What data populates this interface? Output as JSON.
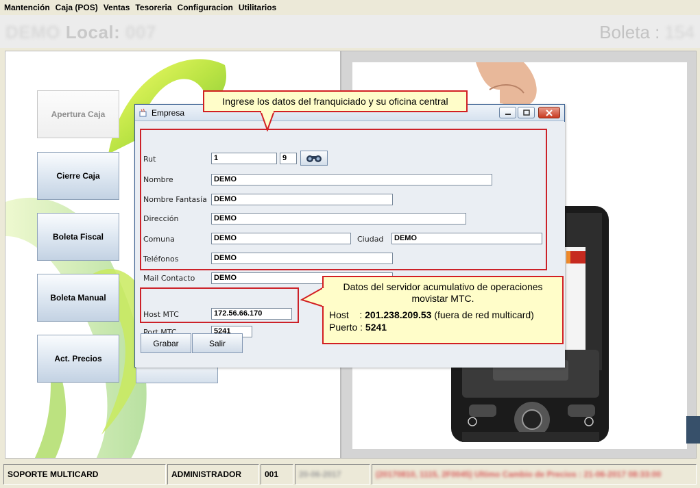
{
  "menu": [
    "Mantención",
    "Caja (POS)",
    "Ventas",
    "Tesoreria",
    "Configuracion",
    "Utilitarios"
  ],
  "header": {
    "local_name": "DEMO",
    "local_label": "Local:",
    "local_number": "007",
    "boleta_label": "Boleta :",
    "boleta_number": "154"
  },
  "side_buttons": [
    "Apertura Caja",
    "Cierre Caja",
    "Boleta Fiscal",
    "Boleta Manual",
    "Act. Precios"
  ],
  "dialog": {
    "title": "Empresa",
    "fields": {
      "rut_label": "Rut",
      "rut_value": "1",
      "rut_dv": "9",
      "nombre_label": "Nombre",
      "nombre_value": "DEMO",
      "fantasia_label": "Nombre Fantasía",
      "fantasia_value": "DEMO",
      "direccion_label": "Dirección",
      "direccion_value": "DEMO",
      "comuna_label": "Comuna",
      "comuna_value": "DEMO",
      "ciudad_label": "Ciudad",
      "ciudad_value": "DEMO",
      "telefonos_label": "Teléfonos",
      "telefonos_value": "DEMO",
      "mail_label": "Mail Contacto",
      "mail_value": "DEMO",
      "host_label": "Host MTC",
      "host_value": "172.56.66.170",
      "port_label": "Port MTC",
      "port_value": "5241"
    },
    "buttons": {
      "grabar": "Grabar",
      "salir": "Salir"
    }
  },
  "callouts": {
    "top": "Ingrese los datos del franquiciado y su oficina central",
    "server_line1": "Datos del servidor acumulativo de operaciones",
    "server_line2": "movistar MTC.",
    "host_label": "Host    : ",
    "host_value": "201.238.209.53",
    "host_note": " (fuera de red multicard)",
    "puerto_label": "Puerto : ",
    "puerto_value": "5241"
  },
  "statusbar": {
    "support": "SOPORTE MULTICARD",
    "user": "ADMINISTRADOR",
    "code": "001",
    "date": "20-06-2017",
    "message": "(20170810, 1115, 2F0045) Ultimo Cambio de Precios : 21-06-2017 08:33:00"
  },
  "colors": {
    "accent_red": "#cc2128",
    "callout_bg": "#fffdc9",
    "button_blue": "#c3d2e3"
  }
}
